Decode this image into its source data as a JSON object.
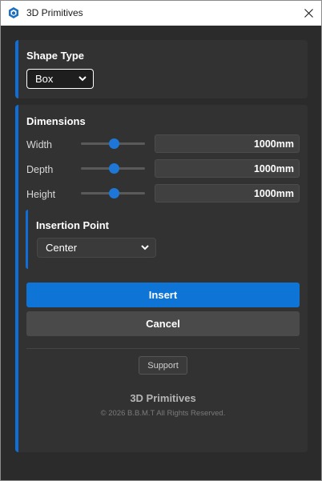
{
  "window": {
    "title": "3D Primitives",
    "icon": "sketchup-cube-icon"
  },
  "shape_type": {
    "title": "Shape Type",
    "selected": "Box"
  },
  "dimensions": {
    "title": "Dimensions",
    "rows": [
      {
        "label": "Width",
        "value": "1000mm",
        "slider_fraction": 0.5
      },
      {
        "label": "Depth",
        "value": "1000mm",
        "slider_fraction": 0.5
      },
      {
        "label": "Height",
        "value": "1000mm",
        "slider_fraction": 0.5
      }
    ]
  },
  "insertion_point": {
    "title": "Insertion Point",
    "selected": "Center"
  },
  "actions": {
    "insert_label": "Insert",
    "cancel_label": "Cancel",
    "support_label": "Support"
  },
  "footer": {
    "title": "3D Primitives",
    "copyright": "© 2026 B.B.M.T All Rights Reserved."
  },
  "colors": {
    "accent": "#0e74d6",
    "background": "#2b2b2b",
    "panel": "#323232"
  }
}
